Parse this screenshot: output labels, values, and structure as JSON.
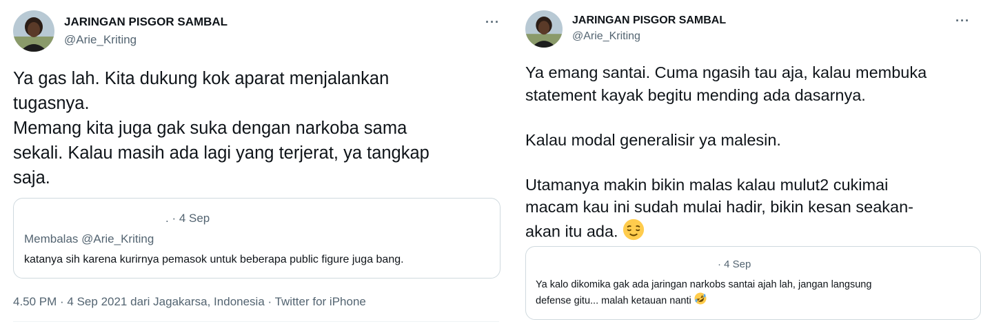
{
  "left": {
    "display_name": "JARINGAN PISGOR SAMBAL",
    "handle": "@Arie_Kriting",
    "more_label": "···",
    "text": "Ya gas lah. Kita dukung kok aparat menjalankan\ntugasnya.\nMemang kita juga gak suka dengan narkoba sama\nsekali. Kalau masih ada lagi yang terjerat, ya tangkap\nsaja.",
    "quote": {
      "meta": ". · 4 Sep",
      "reply_to": "Membalas @Arie_Kriting",
      "text": "katanya sih karena kurirnya pemasok untuk beberapa public figure juga bang."
    },
    "footer": "4.50 PM · 4 Sep 2021 dari Jagakarsa, Indonesia · Twitter for iPhone"
  },
  "right": {
    "display_name": "JARINGAN PISGOR SAMBAL",
    "handle": "@Arie_Kriting",
    "more_label": "···",
    "text": "Ya emang santai. Cuma ngasih tau aja, kalau membuka\nstatement kayak begitu mending ada dasarnya.\n\nKalau modal generalisir ya malesin.\n\nUtamanya makin bikin malas kalau mulut2 cukimai\nmacam kau ini sudah mulai hadir, bikin kesan seakan-\nakan itu ada.",
    "emoji": "relieved-face",
    "quote": {
      "meta": "· 4 Sep",
      "text": "Ya kalo dikomika gak ada jaringan narkobs santai ajah lah, jangan langsung\ndefense gitu... malah ketauan nanti",
      "emoji": "rolling-on-floor-laughing"
    }
  },
  "colors": {
    "text_primary": "#0f1419",
    "text_secondary": "#536471",
    "border": "#cfd9de",
    "emoji_yellow": "#ffcc4d"
  }
}
